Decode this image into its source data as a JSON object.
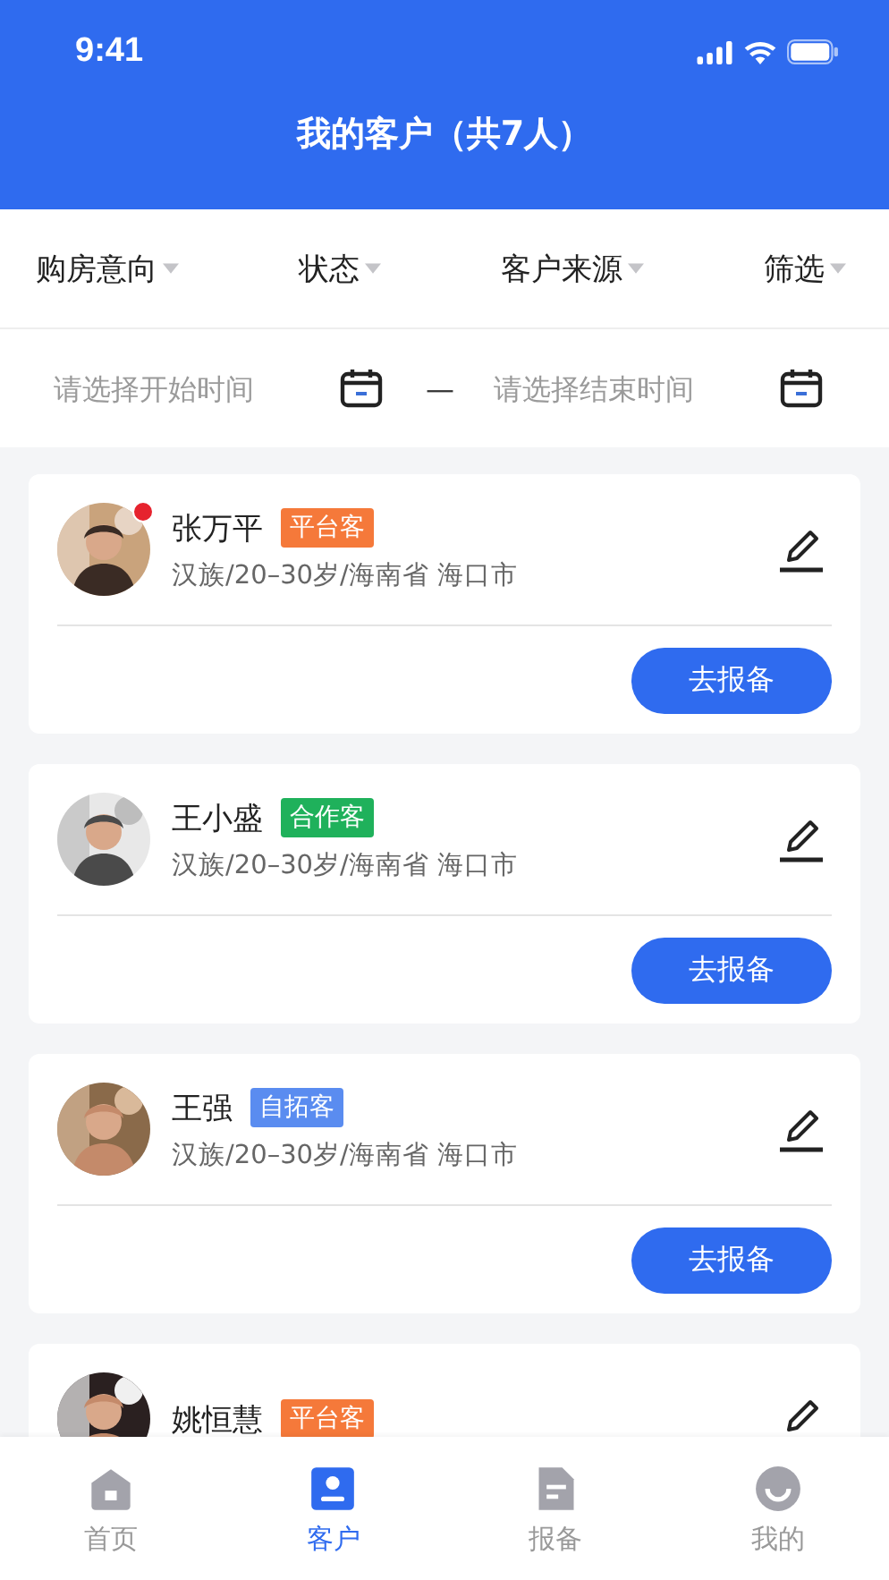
{
  "status_bar": {
    "time": "9:41"
  },
  "header": {
    "title": "我的客户（共7人）"
  },
  "filters": [
    {
      "label": "购房意向"
    },
    {
      "label": "状态"
    },
    {
      "label": "客户来源"
    },
    {
      "label": "筛选"
    }
  ],
  "date_range": {
    "start_placeholder": "请选择开始时间",
    "separator": "—",
    "end_placeholder": "请选择结束时间"
  },
  "customers": [
    {
      "name": "张万平",
      "tag": "平台客",
      "color": "#f5793a",
      "unread": true,
      "info": "汉族/20–30岁/海南省 海口市",
      "button": "去报备"
    },
    {
      "name": "王小盛",
      "tag": "合作客",
      "color": "#1fb15b",
      "unread": false,
      "info": "汉族/20–30岁/海南省 海口市",
      "button": "去报备"
    },
    {
      "name": "王强",
      "tag": "自拓客",
      "color": "#5a8cf0",
      "unread": false,
      "info": "汉族/20–30岁/海南省 海口市",
      "button": "去报备"
    },
    {
      "name": "姚恒慧",
      "tag": "平台客",
      "color": "#f5793a",
      "unread": false
    }
  ],
  "tab_bar": [
    {
      "label": "首页",
      "kind": "home",
      "selected": false
    },
    {
      "label": "客户",
      "kind": "person",
      "selected": true
    },
    {
      "label": "报备",
      "kind": "doc",
      "selected": false
    },
    {
      "label": "我的",
      "kind": "smile",
      "selected": false
    }
  ]
}
